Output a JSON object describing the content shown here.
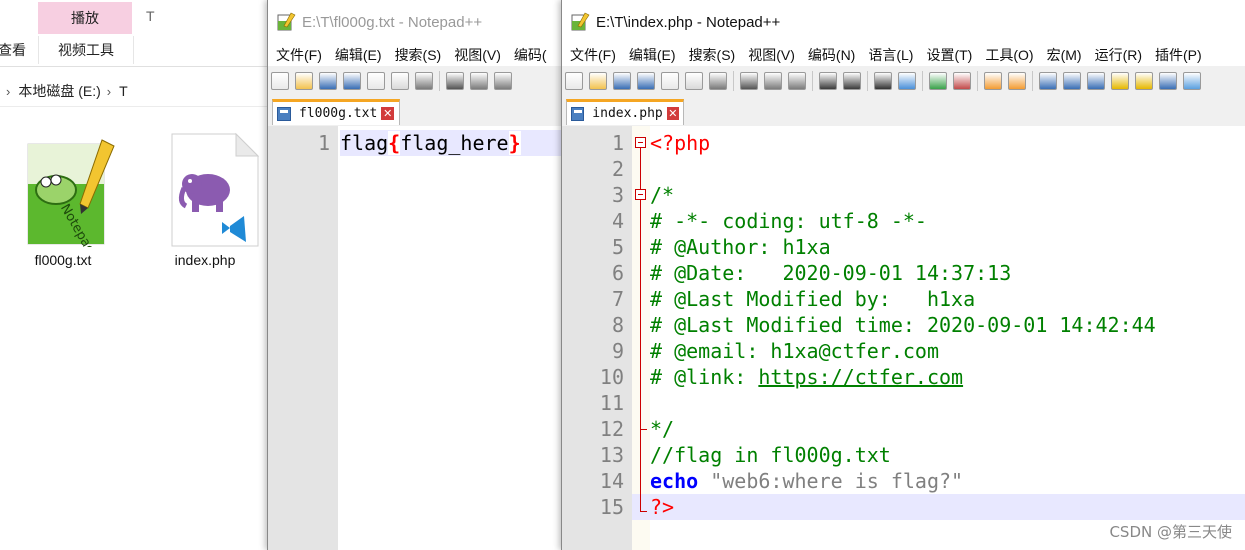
{
  "explorer": {
    "ribbon_tab_play": "播放",
    "ribbon_tab_t": "T",
    "ribbon_view_partial": "查看",
    "ribbon_video_tools": "视频工具",
    "breadcrumb": [
      "本地磁盘 (E:)",
      "T"
    ],
    "files": [
      {
        "name": "fl000g.txt",
        "icon": "notepad-plus-plus-icon"
      },
      {
        "name": "index.php",
        "icon": "php-elephant-icon"
      }
    ]
  },
  "left_window": {
    "title": "E:\\T\\fl000g.txt - Notepad++",
    "menus": [
      "文件(F)",
      "编辑(E)",
      "搜索(S)",
      "视图(V)",
      "编码("
    ],
    "tab_label": "fl000g.txt",
    "lines": [
      {
        "n": "1",
        "segments": [
          {
            "t": "flag",
            "c": "plain"
          },
          {
            "t": "{",
            "c": "red"
          },
          {
            "t": "flag_here",
            "c": "plain"
          },
          {
            "t": "}",
            "c": "red"
          }
        ]
      }
    ]
  },
  "right_window": {
    "title": "E:\\T\\index.php - Notepad++",
    "menus": [
      "文件(F)",
      "编辑(E)",
      "搜索(S)",
      "视图(V)",
      "编码(N)",
      "语言(L)",
      "设置(T)",
      "工具(O)",
      "宏(M)",
      "运行(R)",
      "插件(P)"
    ],
    "tab_label": "index.php",
    "lines": [
      {
        "n": "1",
        "text": "<?php",
        "cls": "ph"
      },
      {
        "n": "2",
        "text": "",
        "cls": ""
      },
      {
        "n": "3",
        "text": "/*",
        "cls": "cm"
      },
      {
        "n": "4",
        "text": "# -*- coding: utf-8 -*-",
        "cls": "cm"
      },
      {
        "n": "5",
        "text": "# @Author: h1xa",
        "cls": "cm"
      },
      {
        "n": "6",
        "text": "# @Date:   2020-09-01 14:37:13",
        "cls": "cm"
      },
      {
        "n": "7",
        "text": "# @Last Modified by:   h1xa",
        "cls": "cm"
      },
      {
        "n": "8",
        "text": "# @Last Modified time: 2020-09-01 14:42:44",
        "cls": "cm"
      },
      {
        "n": "9",
        "text": "# @email: h1xa@ctfer.com",
        "cls": "cm"
      },
      {
        "n": "10",
        "text": "# @link: ",
        "cls": "cm",
        "link": "https://ctfer.com"
      },
      {
        "n": "11",
        "text": "",
        "cls": ""
      },
      {
        "n": "12",
        "text": "*/",
        "cls": "cm"
      },
      {
        "n": "13",
        "text": "//flag in fl000g.txt",
        "cls": "cm"
      },
      {
        "n": "14",
        "kw": "echo",
        "str": " \"web6:where is flag?\"",
        "cls": ""
      },
      {
        "n": "15",
        "text": "?>",
        "cls": "ph"
      }
    ]
  },
  "watermark": "CSDN @第三天使",
  "colors": {
    "tab_accent": "#f5a623",
    "current_line": "#e8e8ff",
    "comment": "#008000",
    "keyword": "#0000ff",
    "php_tag": "#ff0000"
  }
}
